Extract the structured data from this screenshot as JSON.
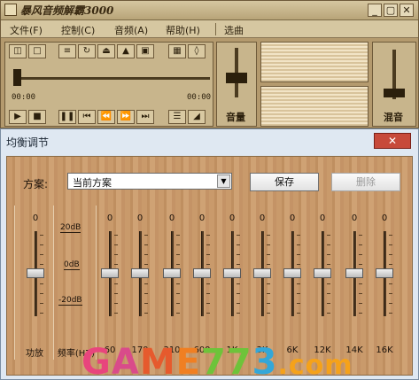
{
  "player": {
    "title": "暴风音频解霸3000",
    "window_buttons": [
      "_",
      "▢",
      "✕"
    ],
    "menu": [
      "文件(F)",
      "控制(C)",
      "音频(A)",
      "帮助(H)",
      "选曲"
    ],
    "time_left": "00:00",
    "time_right": "00:00",
    "volume_label": "音量",
    "mix_label": "混音"
  },
  "equalizer": {
    "title": "均衡调节",
    "close_glyph": "✕",
    "scheme_label": "方案:",
    "scheme_value": "当前方案",
    "save_button": "保存",
    "delete_button": "删除",
    "db_labels": [
      "20dB",
      "0dB",
      "-20dB"
    ],
    "amp_label": "功放",
    "freq_label": "频率(HZ)",
    "bands": [
      "60",
      "170",
      "310",
      "600",
      "1K",
      "3K",
      "6K",
      "12K",
      "14K",
      "16K"
    ],
    "gains": [
      "0",
      "0",
      "0",
      "0",
      "0",
      "0",
      "0",
      "0",
      "0",
      "0",
      "0"
    ]
  },
  "watermark": {
    "g": "G",
    "a": "A",
    "m": "M",
    "e": "E",
    "seven": "77",
    "three": "3",
    "com": ".com"
  }
}
